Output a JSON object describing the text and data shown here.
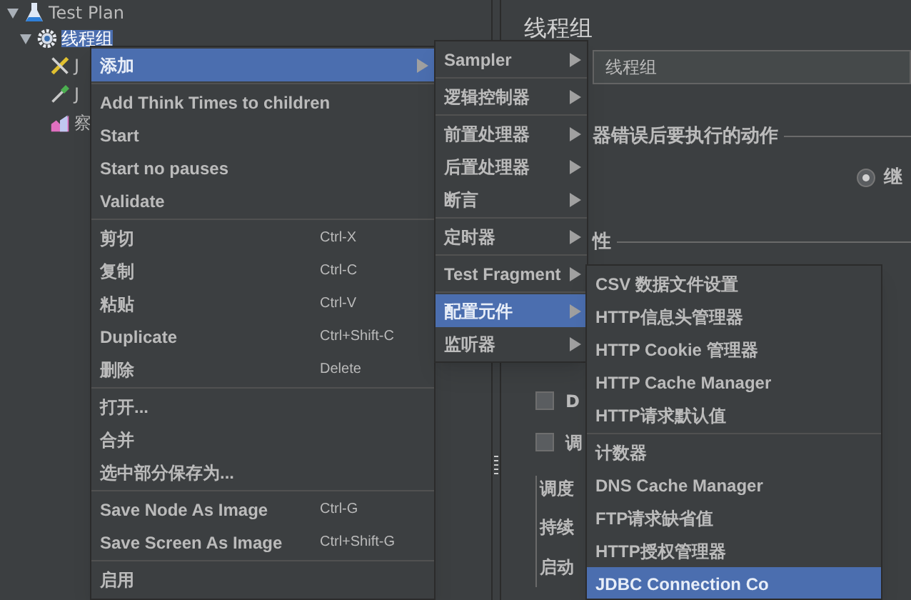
{
  "tree": [
    {
      "label": "Test Plan",
      "expanded": true,
      "selected": false,
      "children": [
        {
          "label": "线程组",
          "expanded": true,
          "selected": true,
          "children": [
            {
              "label": "J",
              "selected": false
            },
            {
              "label": "J",
              "selected": false
            },
            {
              "label": "察",
              "selected": false
            }
          ]
        }
      ]
    }
  ],
  "form": {
    "title": "线程组",
    "name_value": "线程组",
    "error_legend": "器错误后要执行的动作",
    "radio": {
      "label": "继",
      "selected": true
    },
    "props_legend": "性",
    "checkboxes": [
      {
        "label": "D",
        "checked": false
      },
      {
        "label": "调",
        "checked": false
      }
    ],
    "scheduler_legend": "调度",
    "scheduler_fields": [
      "持续",
      "启动"
    ]
  },
  "context_menu": [
    [
      {
        "label": "添加",
        "submenu": true,
        "selected": true
      }
    ],
    [
      {
        "label": "Add Think Times to children",
        "selected": false
      },
      {
        "label": "Start",
        "selected": false
      },
      {
        "label": "Start no pauses",
        "selected": false
      },
      {
        "label": "Validate",
        "selected": false
      }
    ],
    [
      {
        "label": "剪切",
        "shortcut": "Ctrl-X",
        "selected": false
      },
      {
        "label": "复制",
        "shortcut": "Ctrl-C",
        "selected": false
      },
      {
        "label": "粘贴",
        "shortcut": "Ctrl-V",
        "selected": false
      },
      {
        "label": "Duplicate",
        "shortcut": "Ctrl+Shift-C",
        "selected": false
      },
      {
        "label": "删除",
        "shortcut": "Delete",
        "selected": false
      }
    ],
    [
      {
        "label": "打开...",
        "selected": false
      },
      {
        "label": "合并",
        "selected": false
      },
      {
        "label": "选中部分保存为...",
        "selected": false
      }
    ],
    [
      {
        "label": "Save Node As Image",
        "shortcut": "Ctrl-G",
        "selected": false
      },
      {
        "label": "Save Screen As Image",
        "shortcut": "Ctrl+Shift-G",
        "selected": false
      }
    ],
    [
      {
        "label": "启用",
        "selected": false
      }
    ]
  ],
  "add_submenu": [
    [
      {
        "label": "Sampler",
        "submenu": true,
        "selected": false
      }
    ],
    [
      {
        "label": "逻辑控制器",
        "submenu": true,
        "selected": false
      }
    ],
    [
      {
        "label": "前置处理器",
        "submenu": true,
        "selected": false
      },
      {
        "label": "后置处理器",
        "submenu": true,
        "selected": false
      },
      {
        "label": "断言",
        "submenu": true,
        "selected": false
      }
    ],
    [
      {
        "label": "定时器",
        "submenu": true,
        "selected": false
      }
    ],
    [
      {
        "label": "Test Fragment",
        "submenu": true,
        "selected": false
      }
    ],
    [
      {
        "label": "配置元件",
        "submenu": true,
        "selected": true
      },
      {
        "label": "监听器",
        "submenu": true,
        "selected": false
      }
    ]
  ],
  "config_submenu": [
    [
      {
        "label": "CSV 数据文件设置",
        "selected": false
      },
      {
        "label": "HTTP信息头管理器",
        "selected": false
      },
      {
        "label": "HTTP Cookie 管理器",
        "selected": false
      },
      {
        "label": "HTTP Cache Manager",
        "selected": false
      },
      {
        "label": "HTTP请求默认值",
        "selected": false
      }
    ],
    [
      {
        "label": "计数器",
        "selected": false
      },
      {
        "label": "DNS Cache Manager",
        "selected": false
      },
      {
        "label": "FTP请求缺省值",
        "selected": false
      },
      {
        "label": "HTTP授权管理器",
        "selected": false
      },
      {
        "label": "JDBC Connection Co",
        "selected": true
      }
    ]
  ]
}
